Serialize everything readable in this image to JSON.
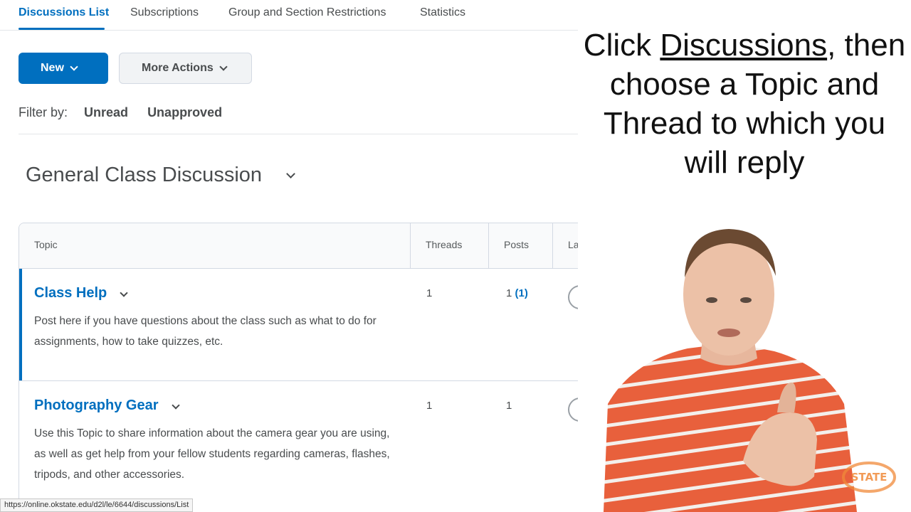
{
  "tabs": [
    {
      "label": "Discussions List",
      "active": true
    },
    {
      "label": "Subscriptions",
      "active": false
    },
    {
      "label": "Group and Section Restrictions",
      "active": false
    },
    {
      "label": "Statistics",
      "active": false
    }
  ],
  "toolbar": {
    "new_label": "New",
    "more_actions_label": "More Actions"
  },
  "filter": {
    "label": "Filter by:",
    "options": [
      "Unread",
      "Unapproved"
    ]
  },
  "forum": {
    "title": "General Class Discussion"
  },
  "table": {
    "headers": [
      "Topic",
      "Threads",
      "Posts",
      "La"
    ],
    "rows": [
      {
        "title": "Class Help",
        "description": "Post here if you have questions about the class such as what to do for assignments, how to take quizzes, etc.",
        "threads": "1",
        "posts": "1",
        "unread_posts": "(1)"
      },
      {
        "title": "Photography Gear",
        "description": "Use this Topic to share information about the camera gear you are using, as well as get help from your fellow students regarding cameras, flashes, tripods, and other accessories.",
        "threads": "1",
        "posts": "1"
      }
    ]
  },
  "status_bar": {
    "url": "https://online.okstate.edu/d2l/le/6644/discussions/List"
  },
  "overlay": {
    "caption_pre": "Click ",
    "caption_link": "Discussions",
    "caption_post": ", then choose a Topic and Thread to which you will reply"
  },
  "logo": {
    "text": "STATE"
  },
  "colors": {
    "accent": "#006fbf",
    "text": "#494c4e",
    "shirt": "#e8603c"
  }
}
